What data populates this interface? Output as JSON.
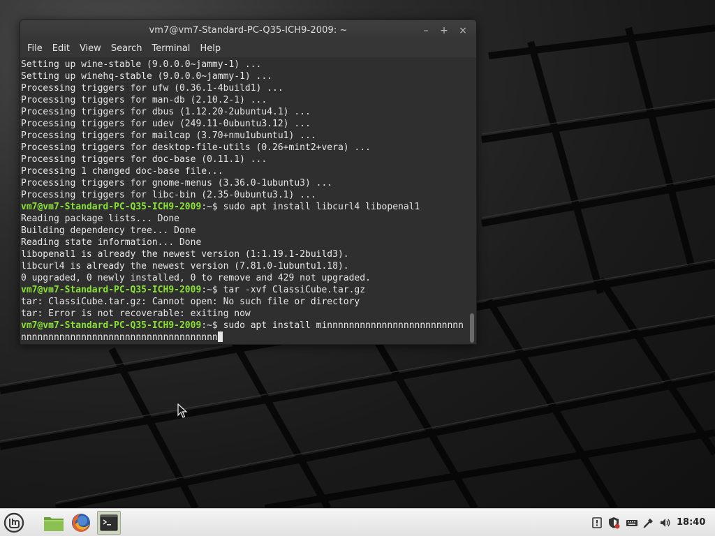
{
  "window": {
    "title": "vm7@vm7-Standard-PC-Q35-ICH9-2009: ~",
    "controls": [
      "–",
      "+",
      "×"
    ]
  },
  "menu": [
    "File",
    "Edit",
    "View",
    "Search",
    "Terminal",
    "Help"
  ],
  "terminal": {
    "lines": [
      {
        "prompt": "",
        "text": "Setting up wine-stable (9.0.0.0~jammy-1) ..."
      },
      {
        "prompt": "",
        "text": "Setting up winehq-stable (9.0.0.0~jammy-1) ..."
      },
      {
        "prompt": "",
        "text": "Processing triggers for ufw (0.36.1-4build1) ..."
      },
      {
        "prompt": "",
        "text": "Processing triggers for man-db (2.10.2-1) ..."
      },
      {
        "prompt": "",
        "text": "Processing triggers for dbus (1.12.20-2ubuntu4.1) ..."
      },
      {
        "prompt": "",
        "text": "Processing triggers for udev (249.11-0ubuntu3.12) ..."
      },
      {
        "prompt": "",
        "text": "Processing triggers for mailcap (3.70+nmu1ubuntu1) ..."
      },
      {
        "prompt": "",
        "text": "Processing triggers for desktop-file-utils (0.26+mint2+vera) ..."
      },
      {
        "prompt": "",
        "text": "Processing triggers for doc-base (0.11.1) ..."
      },
      {
        "prompt": "",
        "text": "Processing 1 changed doc-base file..."
      },
      {
        "prompt": "",
        "text": "Processing triggers for gnome-menus (3.36.0-1ubuntu3) ..."
      },
      {
        "prompt": "",
        "text": "Processing triggers for libc-bin (2.35-0ubuntu3.1) ..."
      },
      {
        "prompt": "vm7@vm7-Standard-PC-Q35-ICH9-2009",
        "text": ":~$ sudo apt install libcurl4 libopenal1"
      },
      {
        "prompt": "",
        "text": "Reading package lists... Done"
      },
      {
        "prompt": "",
        "text": "Building dependency tree... Done"
      },
      {
        "prompt": "",
        "text": "Reading state information... Done"
      },
      {
        "prompt": "",
        "text": "libopenal1 is already the newest version (1:1.19.1-2build3)."
      },
      {
        "prompt": "",
        "text": "libcurl4 is already the newest version (7.81.0-1ubuntu1.18)."
      },
      {
        "prompt": "",
        "text": "0 upgraded, 0 newly installed, 0 to remove and 429 not upgraded."
      },
      {
        "prompt": "vm7@vm7-Standard-PC-Q35-ICH9-2009",
        "text": ":~$ tar -xvf ClassiCube.tar.gz"
      },
      {
        "prompt": "",
        "text": "tar: ClassiCube.tar.gz: Cannot open: No such file or directory"
      },
      {
        "prompt": "",
        "text": "tar: Error is not recoverable: exiting now"
      },
      {
        "prompt": "vm7@vm7-Standard-PC-Q35-ICH9-2009",
        "text": ":~$ sudo apt install minnnnnnnnnnnnnnnnnnnnnnnnn"
      },
      {
        "prompt": "",
        "text": "nnnnnnnnnnnnnnnnnnnnnnnnnnnnnnnnnnnn",
        "cursor": true
      }
    ]
  },
  "taskbar": {
    "launchers": [
      "mint-menu-icon",
      "files-folder-icon",
      "firefox-icon",
      "terminal-icon"
    ],
    "tray": [
      "notification-icon",
      "shield-update-icon",
      "keyboard-icon",
      "network-icon",
      "volume-icon"
    ],
    "clock": "18:40"
  },
  "colors": {
    "prompt": "#8ae234",
    "terminal_bg": "#2f2f2f",
    "terminal_fg": "#e6e6e6"
  }
}
